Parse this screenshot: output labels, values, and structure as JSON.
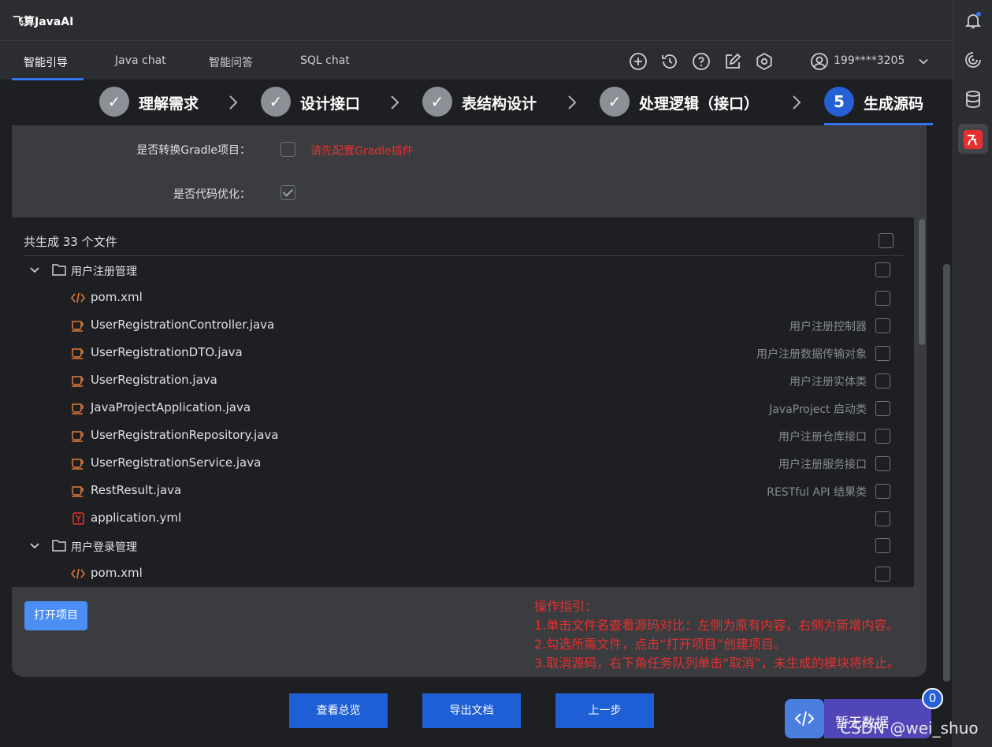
{
  "app": {
    "title": "飞算JavaAI"
  },
  "nav": {
    "tabs": [
      {
        "label": "智能引导"
      },
      {
        "label": "Java chat"
      },
      {
        "label": "智能问答"
      },
      {
        "label": "SQL chat"
      }
    ],
    "user": "199****3205"
  },
  "steps": [
    {
      "label": "理解需求",
      "state": "done"
    },
    {
      "label": "设计接口",
      "state": "done"
    },
    {
      "label": "表结构设计",
      "state": "done"
    },
    {
      "label": "处理逻辑（接口）",
      "state": "done"
    },
    {
      "label": "生成源码",
      "state": "current",
      "number": "5"
    }
  ],
  "options": {
    "gradle_label": "是否转换Gradle项目：",
    "gradle_checked": false,
    "gradle_warning": "请先配置Gradle插件",
    "optimize_label": "是否代码优化：",
    "optimize_checked": true
  },
  "files": {
    "summary": "共生成 33 个文件",
    "groups": [
      {
        "name": "用户注册管理",
        "items": [
          {
            "name": "pom.xml",
            "desc": "",
            "icon": "xml-code-icon"
          },
          {
            "name": "UserRegistrationController.java",
            "desc": "用户注册控制器",
            "icon": "java-cup-icon"
          },
          {
            "name": "UserRegistrationDTO.java",
            "desc": "用户注册数据传输对象",
            "icon": "java-cup-icon"
          },
          {
            "name": "UserRegistration.java",
            "desc": "用户注册实体类",
            "icon": "java-cup-icon"
          },
          {
            "name": "JavaProjectApplication.java",
            "desc": "JavaProject 启动类",
            "icon": "java-cup-icon"
          },
          {
            "name": "UserRegistrationRepository.java",
            "desc": "用户注册仓库接口",
            "icon": "java-cup-icon"
          },
          {
            "name": "UserRegistrationService.java",
            "desc": "用户注册服务接口",
            "icon": "java-cup-icon"
          },
          {
            "name": "RestResult.java",
            "desc": "RESTful API 结果类",
            "icon": "java-cup-icon"
          },
          {
            "name": "application.yml",
            "desc": "",
            "icon": "yaml-icon"
          }
        ]
      },
      {
        "name": "用户登录管理",
        "items": [
          {
            "name": "pom.xml",
            "desc": "",
            "icon": "xml-code-icon"
          }
        ]
      }
    ]
  },
  "actions": {
    "open_project": "打开项目"
  },
  "guide": {
    "title": "操作指引：",
    "lines": [
      "1.单击文件名查看源码对比：左侧为原有内容，右侧为新增内容。",
      "2.勾选所需文件，点击“打开项目”创建项目。",
      "3.取消源码，右下角任务队列单击“取消”，未生成的模块将终止。"
    ]
  },
  "footer": {
    "overview": "查看总览",
    "export": "导出文档",
    "prev": "上一步"
  },
  "task_queue": {
    "status": "暂无数据",
    "count": "0"
  },
  "watermark": "CSDN @wei_shuo",
  "colors": {
    "accent": "#3574f0",
    "warning": "#e5302e",
    "button": "#1f5fd6"
  }
}
